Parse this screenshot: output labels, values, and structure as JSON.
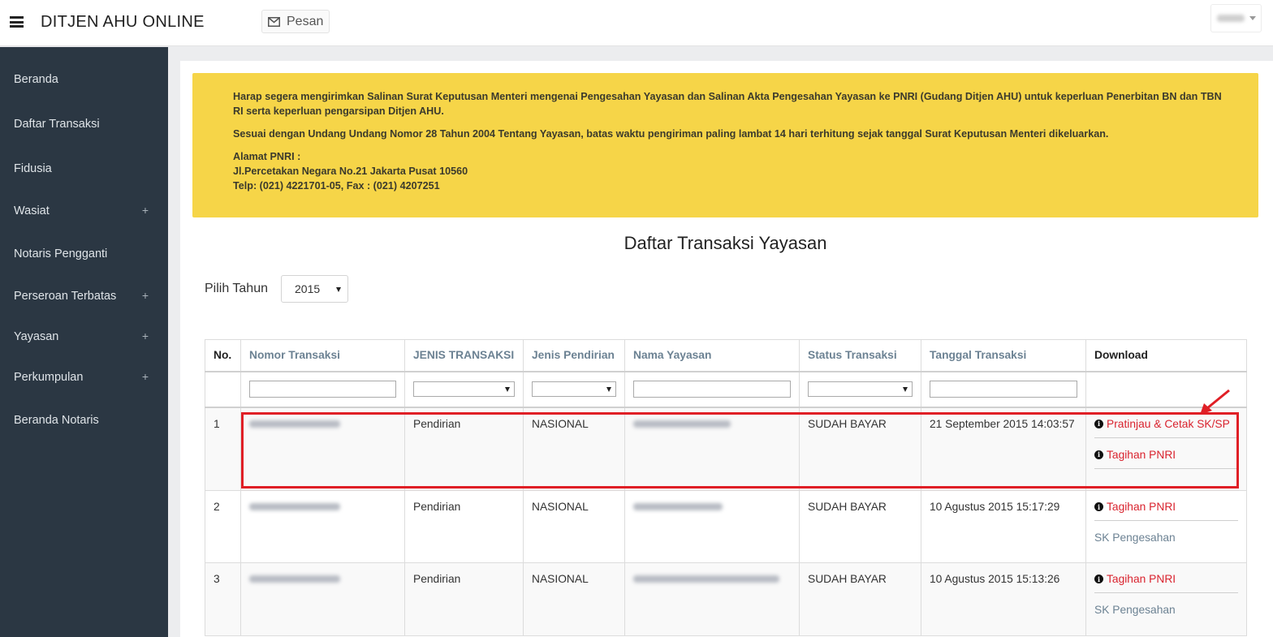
{
  "header": {
    "title": "DITJEN AHU ONLINE",
    "message_label": "Pesan"
  },
  "sidebar": {
    "items": [
      {
        "label": "Beranda",
        "expandable": false
      },
      {
        "label": "Daftar Transaksi",
        "expandable": false
      },
      {
        "label": "Fidusia",
        "expandable": false
      },
      {
        "label": "Wasiat",
        "expandable": true
      },
      {
        "label": "Notaris Pengganti",
        "expandable": false
      },
      {
        "label": "Perseroan Terbatas",
        "expandable": true
      },
      {
        "label": "Yayasan",
        "expandable": true
      },
      {
        "label": "Perkumpulan",
        "expandable": true
      },
      {
        "label": "Beranda Notaris",
        "expandable": false
      }
    ],
    "plus_symbol": "+"
  },
  "alert": {
    "line1": "Harap segera mengirimkan Salinan Surat Keputusan Menteri mengenai Pengesahan Yayasan dan Salinan Akta Pengesahan Yayasan ke PNRI (Gudang Ditjen AHU) untuk keperluan Penerbitan BN dan TBN RI serta keperluan pengarsipan Ditjen AHU.",
    "line2": "Sesuai dengan Undang Undang Nomor 28 Tahun 2004 Tentang Yayasan, batas waktu pengiriman paling lambat 14 hari terhitung sejak tanggal Surat Keputusan Menteri dikeluarkan.",
    "address_title": "Alamat PNRI :",
    "address_line": "Jl.Percetakan Negara No.21 Jakarta Pusat 10560",
    "phone_line": "Telp: (021) 4221701-05, Fax : (021) 4207251"
  },
  "main": {
    "page_title": "Daftar Transaksi Yayasan",
    "year_label": "Pilih Tahun",
    "year_value": "2015"
  },
  "table": {
    "columns": [
      "No.",
      "Nomor Transaksi",
      "JENIS TRANSAKSI",
      "Jenis Pendirian",
      "Nama Yayasan",
      "Status Transaksi",
      "Tanggal Transaksi",
      "Download"
    ],
    "rows": [
      {
        "no": "1",
        "jenis_transaksi": "Pendirian",
        "jenis_pendirian": "NASIONAL",
        "status": "SUDAH BAYAR",
        "tanggal": "21 September 2015 14:03:57",
        "downloads": [
          "Pratinjau & Cetak SK/SP",
          "Tagihan PNRI"
        ]
      },
      {
        "no": "2",
        "jenis_transaksi": "Pendirian",
        "jenis_pendirian": "NASIONAL",
        "status": "SUDAH BAYAR",
        "tanggal": "10 Agustus 2015 15:17:29",
        "downloads": [
          "Tagihan PNRI"
        ],
        "extra_link": "SK Pengesahan"
      },
      {
        "no": "3",
        "jenis_transaksi": "Pendirian",
        "jenis_pendirian": "NASIONAL",
        "status": "SUDAH BAYAR",
        "tanggal": "10 Agustus 2015 15:13:26",
        "downloads": [
          "Tagihan PNRI"
        ],
        "extra_link": "SK Pengesahan"
      }
    ]
  },
  "colors": {
    "sidebar_bg": "#2b3743",
    "alert_bg": "#f6d548",
    "link_red": "#d9232e",
    "status_green": "#3c8a2e",
    "highlight_red": "#e01f26"
  },
  "icons": {
    "menu": "hamburger-icon",
    "message": "envelope-icon",
    "info": "info-circle-icon"
  }
}
